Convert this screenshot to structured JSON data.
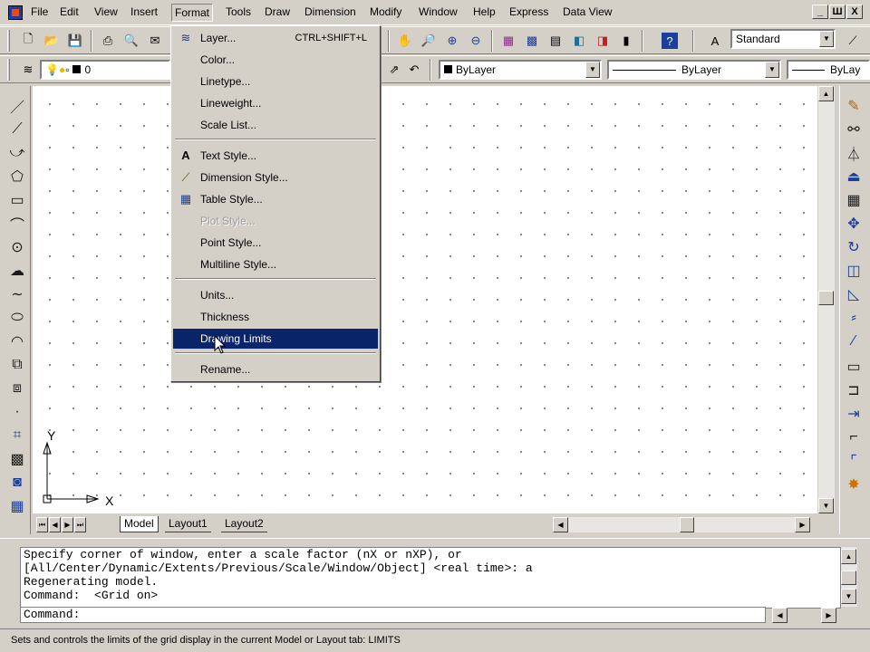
{
  "menubar": {
    "items": [
      "File",
      "Edit",
      "View",
      "Insert",
      "Format",
      "Tools",
      "Draw",
      "Dimension",
      "Modify",
      "Window",
      "Help",
      "Express",
      "Data View"
    ],
    "window_buttons": [
      "_",
      "Ш",
      "X"
    ]
  },
  "toolbar": {
    "text_style_value": "Standard",
    "layer_name": "0",
    "color_value": "ByLayer",
    "linetype_value": "ByLayer",
    "lineweight_value": "ByLay"
  },
  "format_menu": {
    "items": [
      {
        "label": "Layer...",
        "shortcut": "CTRL+SHIFT+L",
        "icon": "layer-icon"
      },
      {
        "label": "Color...",
        "shortcut": ""
      },
      {
        "label": "Linetype...",
        "shortcut": ""
      },
      {
        "label": "Lineweight...",
        "shortcut": ""
      },
      {
        "label": "Scale List...",
        "shortcut": ""
      },
      {
        "label": "Text Style...",
        "shortcut": "",
        "icon": "text-style-icon"
      },
      {
        "label": "Dimension Style...",
        "shortcut": "",
        "icon": "dimension-style-icon"
      },
      {
        "label": "Table Style...",
        "shortcut": "",
        "icon": "table-style-icon"
      },
      {
        "label": "Plot Style...",
        "shortcut": "",
        "disabled": true
      },
      {
        "label": "Point Style...",
        "shortcut": ""
      },
      {
        "label": "Multiline Style...",
        "shortcut": ""
      },
      {
        "label": "Units...",
        "shortcut": ""
      },
      {
        "label": "Thickness",
        "shortcut": ""
      },
      {
        "label": "Drawing Limits",
        "shortcut": "",
        "selected": true
      },
      {
        "label": "Rename...",
        "shortcut": ""
      }
    ]
  },
  "ucs": {
    "y_label": "Y",
    "x_label": "X"
  },
  "tabs": [
    "Model",
    "Layout1",
    "Layout2"
  ],
  "command_history": [
    "Specify corner of window, enter a scale factor (nX or nXP), or",
    "[All/Center/Dynamic/Extents/Previous/Scale/Window/Object] <real time>: a",
    "Regenerating model.",
    "Command:  <Grid on>"
  ],
  "command_prompt": "Command:",
  "status_text": "Sets and controls the limits of the grid display in the current Model or Layout tab:  LIMITS",
  "colors": {
    "selection": "#0a246a",
    "chrome": "#d4d0c8"
  }
}
